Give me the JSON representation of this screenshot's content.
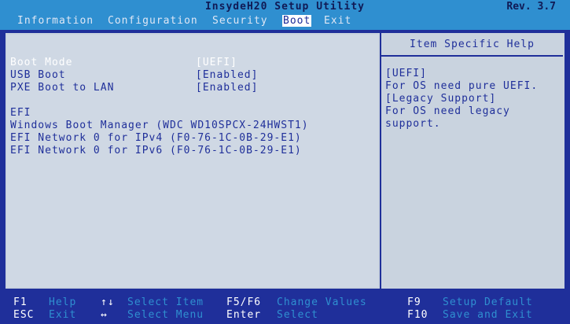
{
  "header": {
    "title": "InsydeH20 Setup Utility",
    "revision": "Rev. 3.7"
  },
  "menu": {
    "tabs": [
      {
        "label": "Information"
      },
      {
        "label": "Configuration"
      },
      {
        "label": "Security"
      },
      {
        "label": "Boot",
        "active": true
      },
      {
        "label": "Exit"
      }
    ]
  },
  "boot": {
    "settings": [
      {
        "label": "Boot Mode",
        "value": "[UEFI]",
        "selected": true
      },
      {
        "label": "USB Boot",
        "value": "[Enabled]"
      },
      {
        "label": "PXE Boot to LAN",
        "value": "[Enabled]"
      }
    ],
    "efi_header": "EFI",
    "efi_entries": [
      "Windows Boot Manager (WDC WD10SPCX-24HWST1)",
      "EFI Network 0 for IPv4 (F0-76-1C-0B-29-E1)",
      "EFI Network 0 for IPv6 (F0-76-1C-0B-29-E1)"
    ]
  },
  "help": {
    "title": "Item Specific Help",
    "lines": [
      "[UEFI]",
      "For OS need pure UEFI.",
      "[Legacy Support]",
      "For OS need legacy",
      "support."
    ]
  },
  "footer": {
    "items": [
      {
        "key": "F1",
        "desc": "Help"
      },
      {
        "key": "ESC",
        "desc": "Exit"
      },
      {
        "key": "↑↓",
        "desc": "Select Item"
      },
      {
        "key": "↔",
        "desc": "Select Menu"
      },
      {
        "key": "F5/F6",
        "desc": "Change Values"
      },
      {
        "key": "Enter",
        "desc": "Select"
      },
      {
        "key": "F9",
        "desc": "Setup Default"
      },
      {
        "key": "F10",
        "desc": "Save and Exit"
      }
    ]
  },
  "colors": {
    "background": "#1f2f9a",
    "bars": "#2f8fd0",
    "panel": "#c9d3df",
    "text_accent": "#1f2f9a"
  }
}
